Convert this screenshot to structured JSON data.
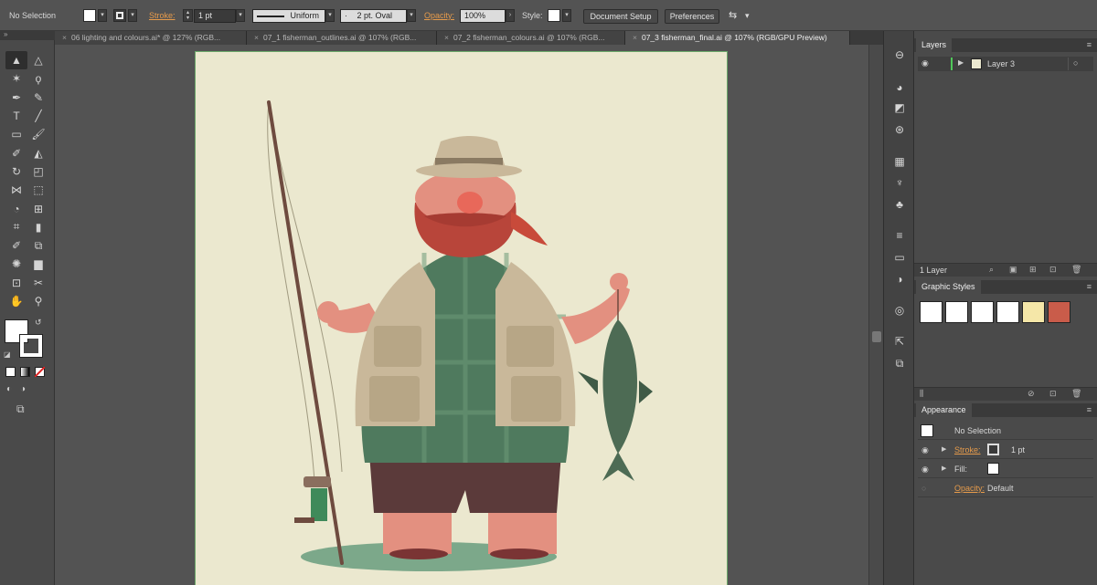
{
  "control_bar": {
    "selection_label": "No Selection",
    "stroke_label": "Stroke:",
    "stroke_weight": "1 pt",
    "stroke_profile": "Uniform",
    "brush": "2 pt. Oval",
    "opacity_label": "Opacity:",
    "opacity_value": "100%",
    "style_label": "Style:",
    "document_setup_button": "Document Setup",
    "preferences_button": "Preferences"
  },
  "tabs": [
    {
      "label": "06 lighting and colours.ai* @ 127% (RGB...",
      "active": false
    },
    {
      "label": "07_1 fisherman_outlines.ai @ 107% (RGB...",
      "active": false
    },
    {
      "label": "07_2 fisherman_colours.ai @ 107% (RGB...",
      "active": false
    },
    {
      "label": "07_3 fisherman_final.ai @ 107% (RGB/GPU Preview)",
      "active": true
    }
  ],
  "tools": [
    "selection-tool",
    "direct-selection-tool",
    "magic-wand-tool",
    "lasso-tool",
    "pen-tool",
    "curvature-tool",
    "type-tool",
    "line-tool",
    "rectangle-tool",
    "paintbrush-tool",
    "shaper-tool",
    "eraser-tool",
    "rotate-tool",
    "scale-tool",
    "width-tool",
    "free-transform-tool",
    "shape-builder-tool",
    "perspective-grid-tool",
    "mesh-tool",
    "gradient-tool",
    "eyedropper-tool",
    "blend-tool",
    "symbol-sprayer-tool",
    "column-graph-tool",
    "artboard-tool",
    "slice-tool",
    "hand-tool",
    "zoom-tool"
  ],
  "tool_glyphs": [
    "▲",
    "△",
    "✶",
    "ϙ",
    "✒",
    "✎",
    "T",
    "╱",
    "▭",
    "🖌",
    "✐",
    "◭",
    "↻",
    "◰",
    "⋈",
    "⬚",
    "◔",
    "⊞",
    "⌗",
    "▮",
    "✐",
    "⧉",
    "✺",
    "▆",
    "⊡",
    "✂",
    "✋",
    "⚲"
  ],
  "layers_panel": {
    "title": "Layers",
    "layer_name": "Layer 3",
    "layer_count": "1 Layer"
  },
  "graphic_styles_panel": {
    "title": "Graphic Styles"
  },
  "appearance_panel": {
    "title": "Appearance",
    "header": "No Selection",
    "stroke_label": "Stroke:",
    "stroke_value": "1 pt",
    "fill_label": "Fill:",
    "opacity_label": "Opacity:",
    "opacity_value": "Default"
  },
  "colors": {
    "artboard": "#ebe8cf",
    "ui_dark": "#535353",
    "accent_orange": "#e69b4b",
    "layer_color": "#4fc75a"
  }
}
